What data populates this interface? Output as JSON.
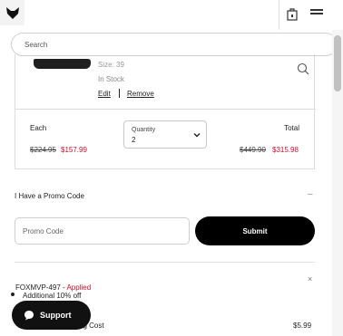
{
  "header": {
    "logo_icon": "fox-head-logo",
    "bag_icon": "shopping-bag-icon",
    "menu_icon": "hamburger-menu-icon"
  },
  "search": {
    "placeholder": "Search"
  },
  "cart_item": {
    "size": "Size: 39",
    "stock": "In Stock",
    "edit": "Edit",
    "remove": "Remove",
    "each_label": "Each",
    "each_old_price": "$224.95",
    "each_new_price": "$157.99",
    "quantity_label": "Quantity",
    "quantity_value": "2",
    "total_label": "Total",
    "total_old_price": "$449.90",
    "total_new_price": "$315.98"
  },
  "promo": {
    "title": "I Have a Promo Code",
    "toggle": "–",
    "placeholder": "Promo Code",
    "submit": "Submit",
    "applied_code": "FOXMVP-497",
    "applied_separator": " - ",
    "applied_status": "Applied",
    "close": "×",
    "discount": "Additional 10% off"
  },
  "shipping": {
    "label": "Estimated Shipping Cost",
    "value": "$5.99"
  },
  "support": {
    "label": "Support"
  },
  "colors": {
    "sale_red": "#c8102e",
    "black": "#000000"
  }
}
